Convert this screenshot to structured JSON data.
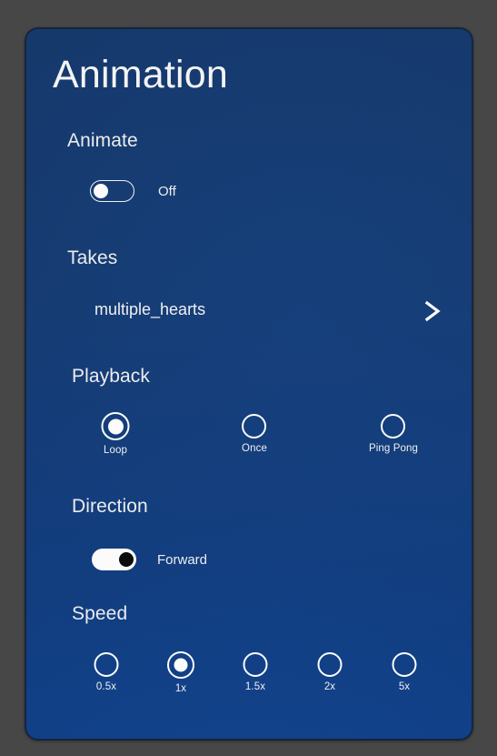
{
  "window": {
    "background_color": "#474747"
  },
  "panel": {
    "title": "Animation",
    "accent_color": "#123d7e",
    "border_color": "#16253d",
    "text_color": "#f0f0f0"
  },
  "sections": {
    "animate": {
      "label": "Animate",
      "toggle": {
        "state": "off",
        "caption": "Off"
      }
    },
    "takes": {
      "label": "Takes",
      "value": "multiple_hearts",
      "chevron_icon": "chevron-right-icon"
    },
    "playback": {
      "label": "Playback",
      "selected": "Loop",
      "options": [
        {
          "label": "Loop",
          "selected": true
        },
        {
          "label": "Once",
          "selected": false
        },
        {
          "label": "Ping Pong",
          "selected": false
        }
      ]
    },
    "direction": {
      "label": "Direction",
      "toggle": {
        "state": "on",
        "caption": "Forward"
      }
    },
    "speed": {
      "label": "Speed",
      "selected": "1x",
      "options": [
        {
          "label": "0.5x",
          "selected": false
        },
        {
          "label": "1x",
          "selected": true
        },
        {
          "label": "1.5x",
          "selected": false
        },
        {
          "label": "2x",
          "selected": false
        },
        {
          "label": "5x",
          "selected": false
        }
      ]
    }
  }
}
